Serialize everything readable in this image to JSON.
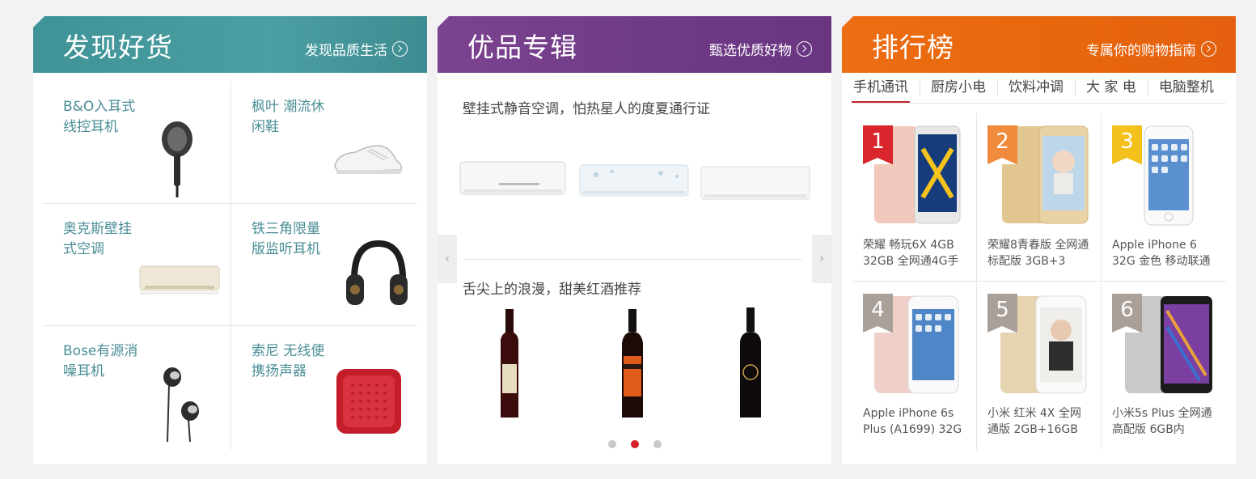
{
  "discover": {
    "title": "发现好货",
    "more": "发现品质生活",
    "items": [
      {
        "line1": "B&O入耳式",
        "line2": "线控耳机"
      },
      {
        "line1": "枫叶 潮流休",
        "line2": "闲鞋"
      },
      {
        "line1": "奥克斯壁挂",
        "line2": "式空调"
      },
      {
        "line1": "铁三角限量",
        "line2": "版监听耳机"
      },
      {
        "line1": "Bose有源消",
        "line2": "噪耳机"
      },
      {
        "line1": "索尼 无线便",
        "line2": "携扬声器"
      }
    ]
  },
  "featured": {
    "title": "优品专辑",
    "more": "甄选优质好物",
    "rec1": "壁挂式静音空调，怕热星人的度夏通行证",
    "rec2": "舌尖上的浪漫，甜美红酒推荐",
    "prev": "‹",
    "next": "›"
  },
  "ranking": {
    "title": "排行榜",
    "more": "专属你的购物指南",
    "tabs": [
      "手机通讯",
      "厨房小电",
      "饮料冲调",
      "大 家 电",
      "电脑整机"
    ],
    "items": [
      {
        "rank": "1",
        "name": "荣耀 畅玩6X 4GB 32GB 全网通4G手",
        "color": "#d9262c"
      },
      {
        "rank": "2",
        "name": "荣耀8青春版 全网通 标配版 3GB+3",
        "color": "#f08a3c"
      },
      {
        "rank": "3",
        "name": "Apple iPhone 6 32G 金色 移动联通",
        "color": "#f4c11c"
      },
      {
        "rank": "4",
        "name": "Apple iPhone 6s Plus (A1699) 32G",
        "color": "#a9a09a"
      },
      {
        "rank": "5",
        "name": "小米 红米 4X 全网通版 2GB+16GB",
        "color": "#a9a09a"
      },
      {
        "rank": "6",
        "name": "小米5s Plus 全网通 高配版 6GB内",
        "color": "#a9a09a"
      }
    ]
  },
  "colors": {
    "discover": "#45999c",
    "featured": "#74408b",
    "ranking": "#e9680e",
    "activeDot": "#d8202a"
  }
}
